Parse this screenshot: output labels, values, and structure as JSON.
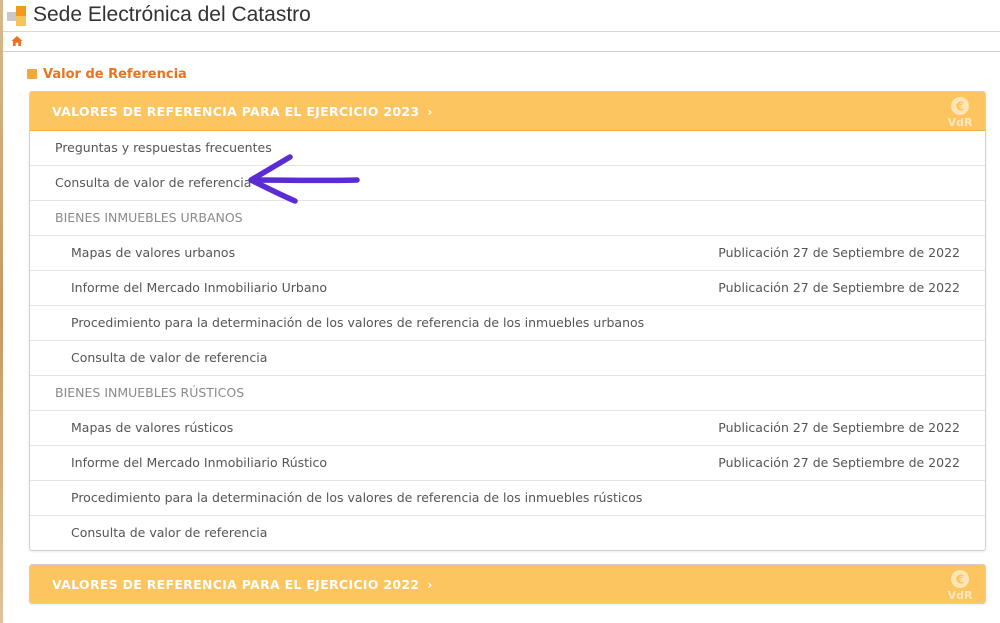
{
  "header": {
    "site_title": "Sede Electrónica del Catastro",
    "logo_colors": [
      "#c8c8c8",
      "#f29a1f",
      "#f7c35b"
    ]
  },
  "nav": {
    "home_icon": "home-icon"
  },
  "section": {
    "title": "Valor de Referencia"
  },
  "colors": {
    "accent": "#e8741f",
    "panel_header": "#fcc55f",
    "annotation_arrow": "#5b2bd6"
  },
  "panel_2023": {
    "title": "VALORES DE REFERENCIA PARA EL EJERCICIO 2023",
    "chevron": "›",
    "badge": "VdR",
    "rows": [
      {
        "label": "Preguntas y respuestas frecuentes",
        "date": ""
      },
      {
        "label": "Consulta de valor de referencia",
        "date": ""
      },
      {
        "label": "BIENES INMUEBLES URBANOS",
        "date": ""
      },
      {
        "label": "Mapas de valores urbanos",
        "date": "Publicación 27 de Septiembre de 2022"
      },
      {
        "label": "Informe del Mercado Inmobiliario Urbano",
        "date": "Publicación 27 de Septiembre de 2022"
      },
      {
        "label": "Procedimiento para la determinación de los valores de referencia de los inmuebles urbanos",
        "date": ""
      },
      {
        "label": "Consulta de valor de referencia",
        "date": ""
      },
      {
        "label": "BIENES INMUEBLES RÚSTICOS",
        "date": ""
      },
      {
        "label": "Mapas de valores rústicos",
        "date": "Publicación 27 de Septiembre de 2022"
      },
      {
        "label": "Informe del Mercado Inmobiliario Rústico",
        "date": "Publicación 27 de Septiembre de 2022"
      },
      {
        "label": "Procedimiento para la determinación de los valores de referencia de los inmuebles rústicos",
        "date": ""
      },
      {
        "label": "Consulta de valor de referencia",
        "date": ""
      }
    ]
  },
  "panel_2022": {
    "title": "VALORES DE REFERENCIA PARA EL EJERCICIO 2022",
    "chevron": "›",
    "badge": "VdR"
  }
}
